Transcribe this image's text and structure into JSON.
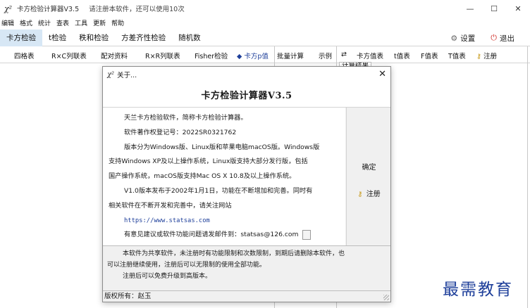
{
  "window": {
    "icon": "χ²",
    "title": "卡方检验计算器V3.5",
    "notice": "请注册本软件，还可以使用10次",
    "controls": [
      "—",
      "☐",
      "✕"
    ]
  },
  "menu": [
    "编辑",
    "格式",
    "统计",
    "查表",
    "工具",
    "更新",
    "帮助"
  ],
  "tabs": [
    "卡方检验",
    "t检验",
    "秩和检验",
    "方差齐性检验",
    "随机数"
  ],
  "toolbar_right": {
    "settings_label": "设置",
    "settings_icon": "gear-icon",
    "exit_label": "退出",
    "exit_icon": "power-icon"
  },
  "subbar": {
    "left_items": [
      "四格表",
      "R×C列联表",
      "配对资料",
      "R×R列联表",
      "Fisher检验",
      "◆ 卡方p值",
      "批量计算",
      "示例"
    ],
    "swap_icon": "⇄",
    "right_items": [
      "卡方值表",
      "t值表",
      "F值表",
      "T值表"
    ],
    "register_label": "注册",
    "calc_result_tab": "计算结果"
  },
  "dialog": {
    "icon": "χ²",
    "caption": "关于...",
    "heading": "卡方检验计算器V3.5",
    "lines": [
      "天兰卡方检验软件，简称卡方检验计算器。",
      "软件著作权登记号：2022SR0321762",
      "版本分为Windows版、Linux版和苹果电脑macOS版。Windows版",
      "支持Windows XP及以上操作系统，Linux版支持大部分发行版，包括",
      "国产操作系统，macOS版支持Mac OS X 10.8及以上操作系统。",
      "V1.0版本发布于2002年1月1日，功能在不断增加和完善。同时有",
      "相关软件在不断开发和完善中，请关注网站",
      "https://www.statsas.com",
      "有意见建议或软件功能问题请发邮件到：statsas@126.com"
    ],
    "ok_label": "确定",
    "register_label": "注册",
    "footer_lines": [
      "本软件为共享软件，未注册时有功能限制和次数限制，到期后请删除本软件，也",
      "可以注册继续使用，注册后可以无限制的使用全部功能。",
      "注册后可以免费升级到高版本。"
    ],
    "copyright": "版权所有：赵玉"
  },
  "watermark": "最需教育"
}
